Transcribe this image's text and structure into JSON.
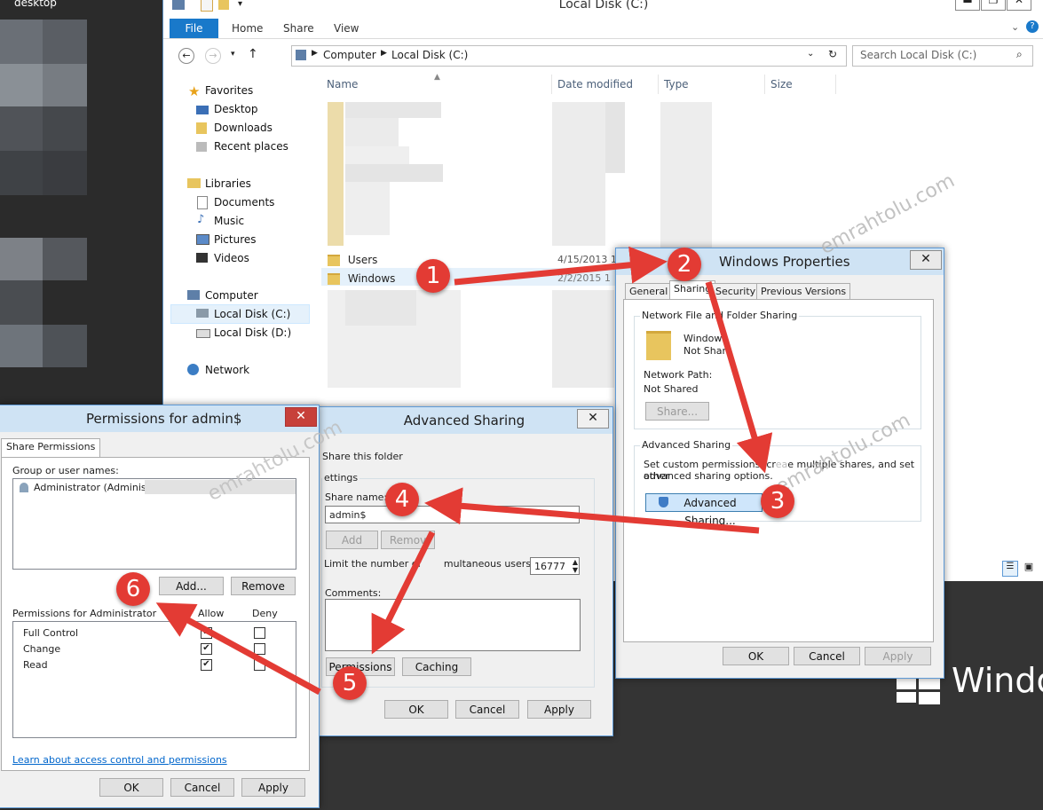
{
  "desktop": {
    "label": "desktop",
    "brand": "Windo"
  },
  "explorer": {
    "title": "Local Disk (C:)",
    "ribbon_tabs": [
      "File",
      "Home",
      "Share",
      "View"
    ],
    "breadcrumb": [
      "Computer",
      "Local Disk (C:)"
    ],
    "search_placeholder": "Search Local Disk (C:)",
    "columns": [
      "Name",
      "Date modified",
      "Type",
      "Size"
    ],
    "nav": {
      "favorites": "Favorites",
      "desktop": "Desktop",
      "downloads": "Downloads",
      "recent": "Recent places",
      "libraries": "Libraries",
      "documents": "Documents",
      "music": "Music",
      "pictures": "Pictures",
      "videos": "Videos",
      "computer": "Computer",
      "drive_c": "Local Disk (C:)",
      "drive_d": "Local Disk (D:)",
      "network": "Network"
    },
    "rows": [
      {
        "name": "Users",
        "date": "4/15/2013 1"
      },
      {
        "name": "Windows",
        "date": "2/2/2015 1"
      }
    ]
  },
  "properties": {
    "title": "Windows Properties",
    "tabs": [
      "General",
      "Sharing",
      "Security",
      "Previous Versions"
    ],
    "network_group": "Network File and Folder Sharing",
    "folder_name": "Window",
    "folder_status": "Not Shar",
    "network_path_label": "Network Path:",
    "network_path_value": "Not Shared",
    "share_button": "Share...",
    "adv_group": "Advanced Sharing",
    "adv_text1": "Set custom permissions, cr",
    "adv_text1b": "e multiple shares, and set other",
    "adv_text2": "advanced sharing options.",
    "adv_button": "Advanced Sharing...",
    "ok": "OK",
    "cancel": "Cancel",
    "apply": "Apply"
  },
  "advanced": {
    "title": "Advanced Sharing",
    "share_folder": "Share this folder",
    "settings": "ettings",
    "share_name_label": "Share name:",
    "share_name_value": "admin$",
    "add": "Add",
    "remove": "Remov",
    "limit_label1": "Limit the number of",
    "limit_label2": "multaneous users to:",
    "limit_value": "16777",
    "comments": "Comments:",
    "permissions": "Permissions",
    "caching": "Caching",
    "ok": "OK",
    "cancel": "Cancel",
    "apply": "Apply"
  },
  "permissions": {
    "title": "Permissions for admin$",
    "tab": "Share Permissions",
    "group_label": "Group or user names:",
    "user": "Administrator (Administrator",
    "add": "Add...",
    "remove": "Remove",
    "perm_label": "Permissions for Administrator",
    "allow": "Allow",
    "deny": "Deny",
    "rows": [
      {
        "name": "Full Control",
        "allow": true,
        "deny": false
      },
      {
        "name": "Change",
        "allow": true,
        "deny": false
      },
      {
        "name": "Read",
        "allow": true,
        "deny": false
      }
    ],
    "link": "Learn about access control and permissions",
    "ok": "OK",
    "cancel": "Cancel",
    "apply": "Apply"
  },
  "watermark": "emrahtolu.com",
  "steps": [
    "1",
    "2",
    "3",
    "4",
    "5",
    "6"
  ],
  "colors": {
    "accent": "#1979ca",
    "step": "#e33b34",
    "title_bar": "#cfe3f4"
  }
}
